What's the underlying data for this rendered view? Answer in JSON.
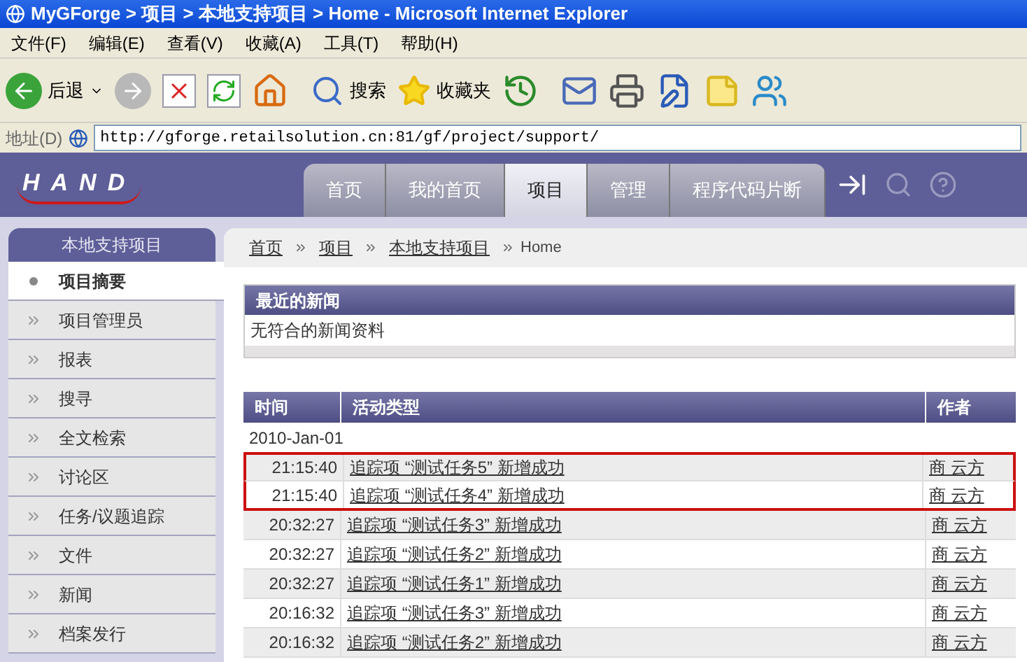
{
  "window": {
    "title": "MyGForge > 项目 > 本地支持项目 > Home - Microsoft Internet Explorer"
  },
  "menu": [
    "文件(F)",
    "编辑(E)",
    "查看(V)",
    "收藏(A)",
    "工具(T)",
    "帮助(H)"
  ],
  "toolbar": {
    "back": "后退",
    "search": "搜索",
    "favorites": "收藏夹"
  },
  "address": {
    "label": "地址(D)",
    "value": "http://gforge.retailsolution.cn:81/gf/project/support/"
  },
  "site": {
    "logo": "HAND",
    "tabs": [
      {
        "label": "首页",
        "selected": false
      },
      {
        "label": "我的首页",
        "selected": false
      },
      {
        "label": "项目",
        "selected": true
      },
      {
        "label": "管理",
        "selected": false
      },
      {
        "label": "程序代码片断",
        "selected": false
      }
    ]
  },
  "sidebar": {
    "title": "本地支持项目",
    "items": [
      {
        "label": "项目摘要",
        "selected": true
      },
      {
        "label": "项目管理员",
        "selected": false
      },
      {
        "label": "报表",
        "selected": false
      },
      {
        "label": "搜寻",
        "selected": false
      },
      {
        "label": "全文检索",
        "selected": false
      },
      {
        "label": "讨论区",
        "selected": false
      },
      {
        "label": "任务/议题追踪",
        "selected": false
      },
      {
        "label": "文件",
        "selected": false
      },
      {
        "label": "新闻",
        "selected": false
      },
      {
        "label": "档案发行",
        "selected": false
      }
    ]
  },
  "breadcrumb": {
    "links": [
      "首页",
      "项目",
      "本地支持项目"
    ],
    "current": "Home"
  },
  "news": {
    "title": "最近的新闻",
    "body": "无符合的新闻资料"
  },
  "activity": {
    "columns": [
      "时间",
      "活动类型",
      "作者"
    ],
    "date": "2010-Jan-01",
    "rows": [
      {
        "time": "21:15:40",
        "activity": "追踪项 “测试任务5” 新增成功",
        "author": "商 云方",
        "highlighted": true
      },
      {
        "time": "21:15:40",
        "activity": "追踪项 “测试任务4” 新增成功",
        "author": "商 云方",
        "highlighted": true
      },
      {
        "time": "20:32:27",
        "activity": "追踪项 “测试任务3” 新增成功",
        "author": "商 云方",
        "highlighted": false
      },
      {
        "time": "20:32:27",
        "activity": "追踪项 “测试任务2” 新增成功",
        "author": "商 云方",
        "highlighted": false
      },
      {
        "time": "20:32:27",
        "activity": "追踪项 “测试任务1” 新增成功",
        "author": "商 云方",
        "highlighted": false
      },
      {
        "time": "20:16:32",
        "activity": "追踪项 “测试任务3” 新增成功",
        "author": "商 云方",
        "highlighted": false
      },
      {
        "time": "20:16:32",
        "activity": "追踪项 “测试任务2” 新增成功",
        "author": "商 云方",
        "highlighted": false
      }
    ]
  }
}
